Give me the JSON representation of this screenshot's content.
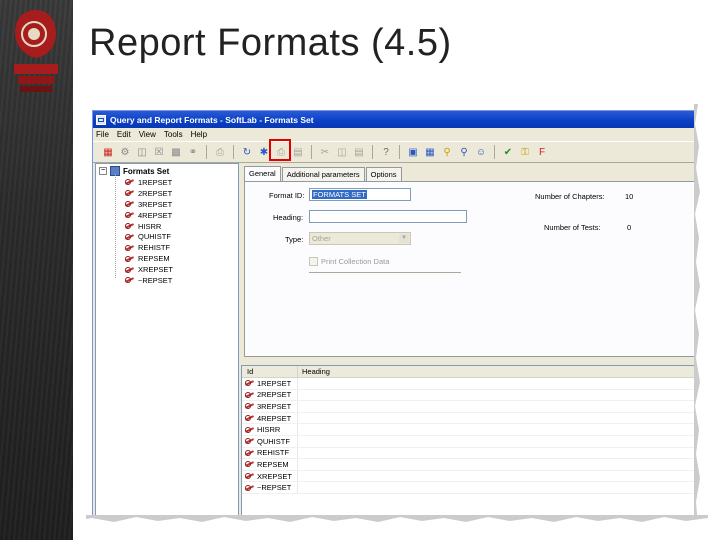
{
  "slide": {
    "title": "Report Formats (4.5)"
  },
  "window": {
    "title": "Query and Report Formats - SoftLab - Formats Set",
    "menu": [
      "File",
      "Edit",
      "View",
      "Tools",
      "Help"
    ],
    "toolbar_icons": [
      "new-icon",
      "properties-icon",
      "copy-icon",
      "delete-icon",
      "save-icon",
      "binoculars-icon",
      "export-icon",
      "refresh-icon",
      "report-format-icon",
      "print-icon",
      "print-preview-icon",
      "cut-icon",
      "copy-doc-icon",
      "paste-icon",
      "help-icon",
      "tree-view-icon",
      "structure-icon",
      "search-icon",
      "zoom-icon",
      "user-icon",
      "check-icon",
      "key-icon",
      "format-icon"
    ],
    "highlighted_icon": "report-format-icon",
    "accent_color": "#e00000"
  },
  "tree": {
    "root": "Formats Set",
    "items": [
      "1REPSET",
      "2REPSET",
      "3REPSET",
      "4REPSET",
      "HISRR",
      "QUHISTF",
      "REHISTF",
      "REPSEM",
      "XREPSET",
      "~REPSET"
    ]
  },
  "tabs": [
    "General",
    "Additional parameters",
    "Options"
  ],
  "general": {
    "format_id_label": "Format ID:",
    "format_id_value": "FORMATS SET",
    "heading_label": "Heading:",
    "heading_value": "",
    "type_label": "Type:",
    "type_value": "Other",
    "print_collection_label": "Print Collection Data",
    "chapters_label": "Number of Chapters:",
    "chapters_value": "10",
    "tests_label": "Number of Tests:",
    "tests_value": "0"
  },
  "list": {
    "columns": [
      "Id",
      "Heading"
    ],
    "rows": [
      {
        "id": "1REPSET",
        "heading": ""
      },
      {
        "id": "2REPSET",
        "heading": ""
      },
      {
        "id": "3REPSET",
        "heading": ""
      },
      {
        "id": "4REPSET",
        "heading": ""
      },
      {
        "id": "HISRR",
        "heading": ""
      },
      {
        "id": "QUHISTF",
        "heading": ""
      },
      {
        "id": "REHISTF",
        "heading": ""
      },
      {
        "id": "REPSEM",
        "heading": ""
      },
      {
        "id": "XREPSET",
        "heading": ""
      },
      {
        "id": "~REPSET",
        "heading": ""
      }
    ]
  }
}
